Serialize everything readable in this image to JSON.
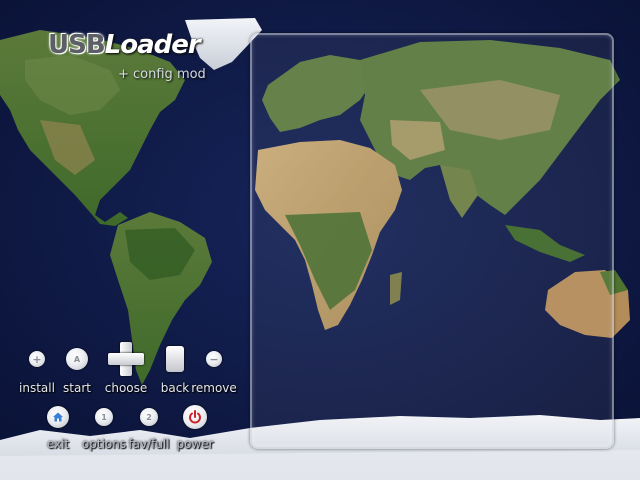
{
  "app": {
    "logo_part1": "USB",
    "logo_part2": "Loader",
    "subtitle": "+ config mod"
  },
  "controls_row1": [
    {
      "icon": "plus-button-icon",
      "glyph": "+",
      "label": "install"
    },
    {
      "icon": "a-button-icon",
      "glyph": "A",
      "label": "start"
    },
    {
      "icon": "dpad-icon",
      "glyph": "",
      "label": "choose"
    },
    {
      "icon": "b-button-icon",
      "glyph": "",
      "label": "back"
    },
    {
      "icon": "minus-button-icon",
      "glyph": "−",
      "label": "remove"
    }
  ],
  "controls_row2": [
    {
      "icon": "home-button-icon",
      "glyph": "",
      "label": "exit"
    },
    {
      "icon": "one-button-icon",
      "glyph": "1",
      "label": "options"
    },
    {
      "icon": "two-button-icon",
      "glyph": "2",
      "label": "fav/full"
    },
    {
      "icon": "power-button-icon",
      "glyph": "⏻",
      "label": "power"
    }
  ],
  "colors": {
    "ocean": "#0f1a45",
    "power_red": "#d0202a",
    "home_blue": "#3a7fd6"
  }
}
